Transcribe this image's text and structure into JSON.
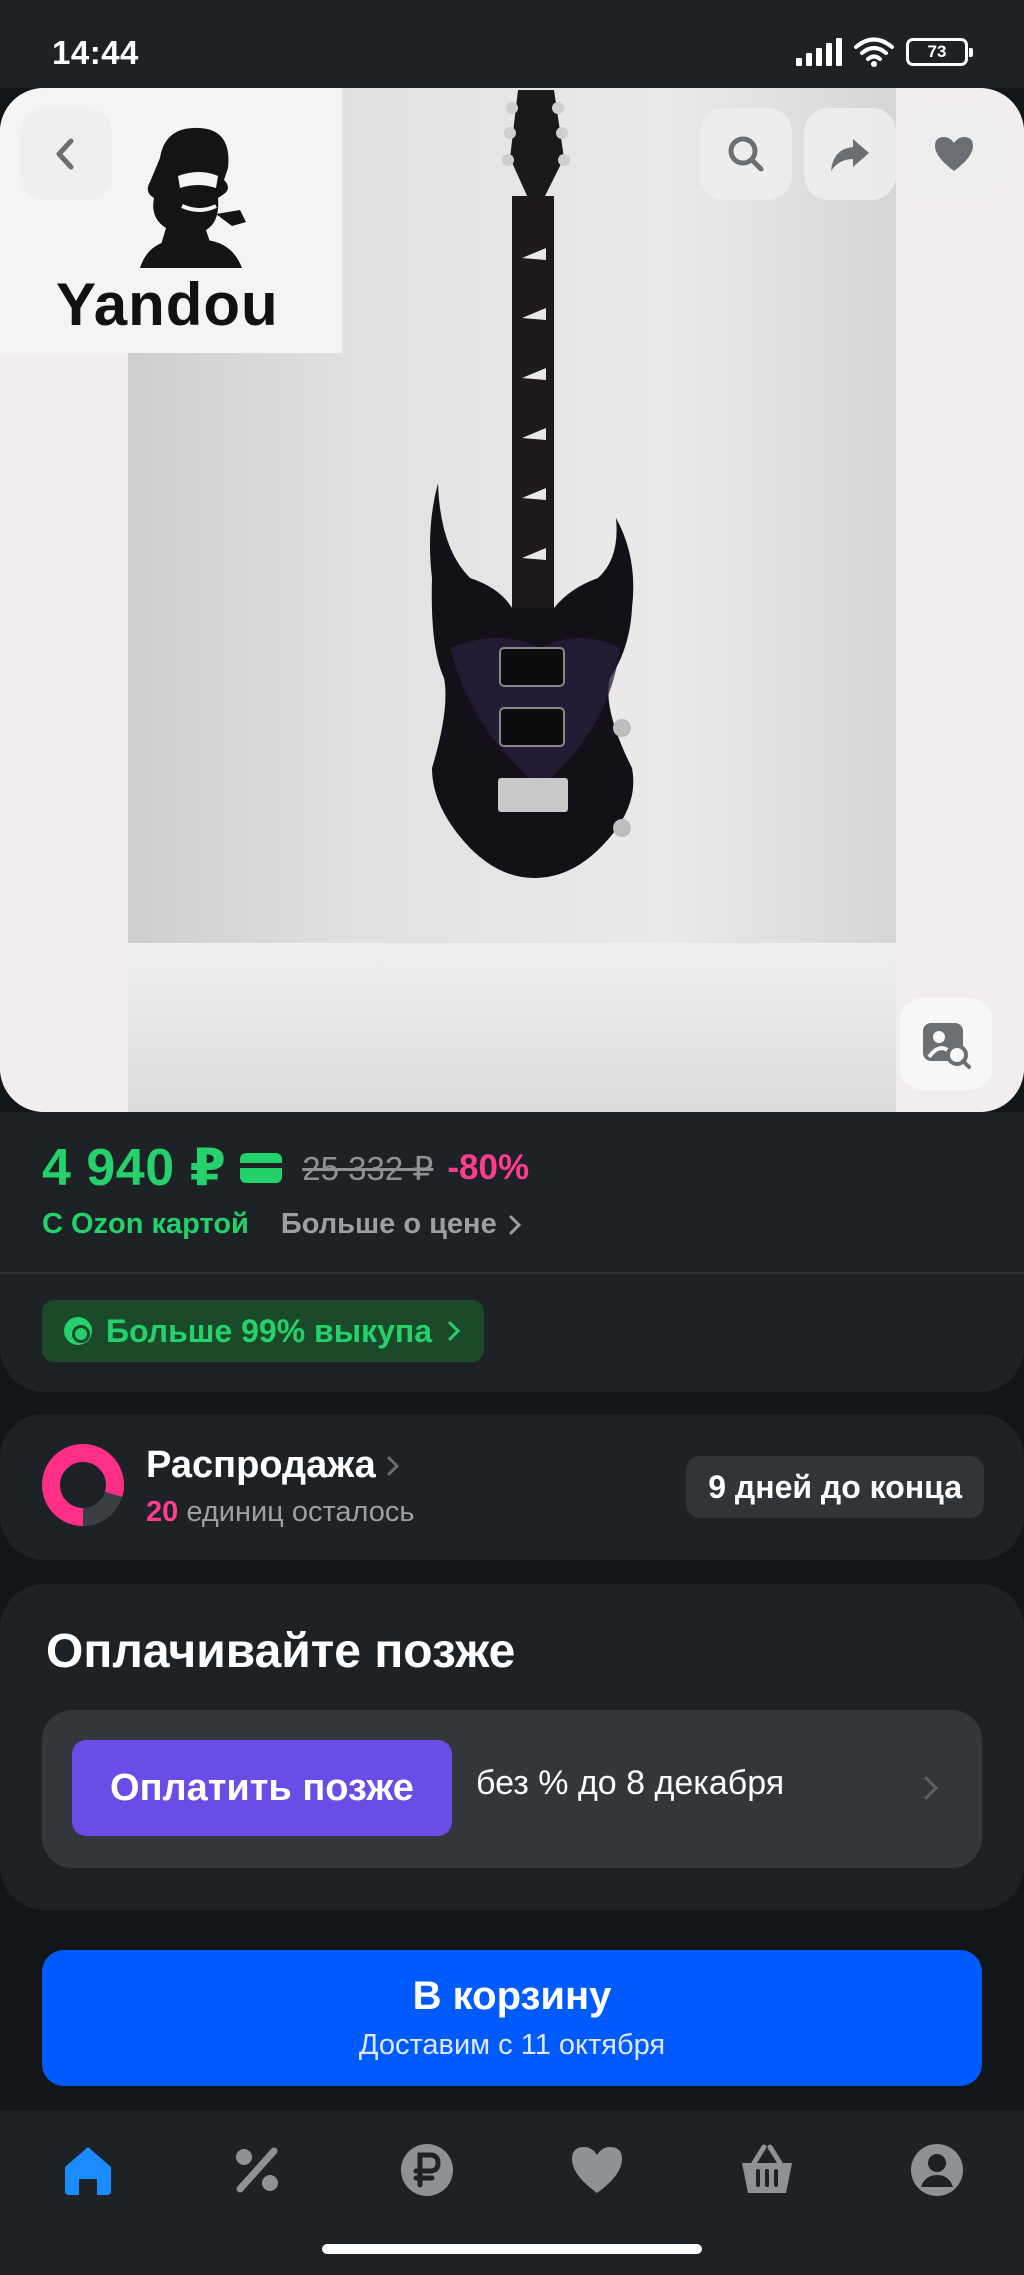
{
  "status_bar": {
    "time": "14:44",
    "battery": "73",
    "icons": [
      "signal-icon",
      "wifi-icon",
      "battery-icon"
    ]
  },
  "product_image": {
    "brand_name": "Yandou",
    "subject": "guitar"
  },
  "top_actions": {
    "back_icon": "chevron-left-icon",
    "search_icon": "search-icon",
    "share_icon": "share-icon",
    "favorite_icon": "heart-icon",
    "image_search_icon": "image-search-icon"
  },
  "price": {
    "current": "4 940 ₽",
    "old": "25 332 ₽",
    "discount": "-80%",
    "ozon_card_label": "С Ozon картой",
    "more_about_price": "Больше о цене",
    "buyout_badge": "Больше 99% выкупа"
  },
  "sale": {
    "title": "Распродажа",
    "units_left_number": "20",
    "units_left_text": "единиц осталось",
    "days_left": "9 дней до конца"
  },
  "pay_later": {
    "title": "Оплачивайте позже",
    "button_label": "Оплатить позже",
    "terms": "без % до 8 декабря"
  },
  "cart": {
    "button_label": "В корзину",
    "delivery_text": "Доставим с 11 октября"
  },
  "bottom_nav": {
    "items": [
      "home-icon",
      "discount-icon",
      "ruble-icon",
      "heart-icon",
      "basket-icon",
      "profile-icon"
    ],
    "active": "home-icon"
  },
  "colors": {
    "background": "#121619",
    "card": "#1d2226",
    "price_green": "#25d16a",
    "discount_pink": "#ff3d8b",
    "pay_later_purple": "#6a4de6",
    "cart_blue": "#005bff",
    "active_nav_blue": "#1a8cff"
  }
}
